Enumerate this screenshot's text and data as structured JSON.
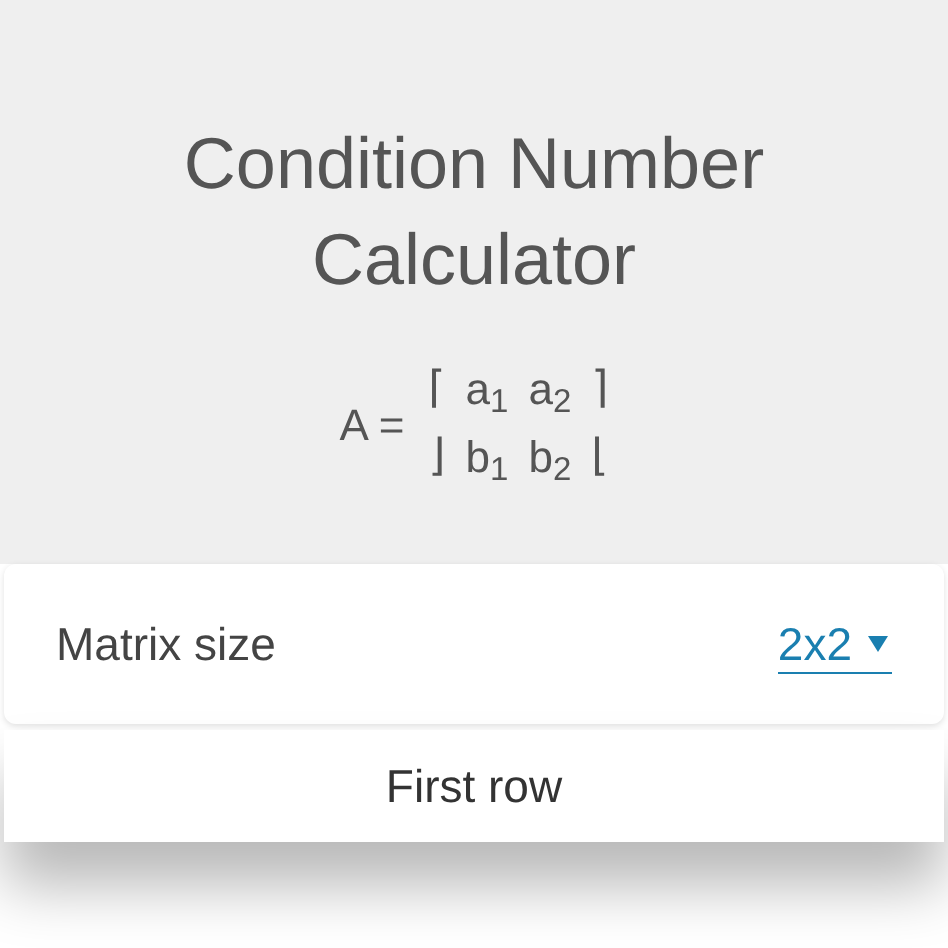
{
  "title": "Condition Number Calculator",
  "matrix": {
    "label": "A =",
    "rows": [
      {
        "left": "⌈",
        "cells": [
          "a$_{1}$",
          "a$_{2}$"
        ],
        "right": "⌉"
      },
      {
        "left": "⌋",
        "cells": [
          "b$_{1}$",
          "b$_{2}$"
        ],
        "right": "⌊"
      }
    ]
  },
  "matrix_size": {
    "label": "Matrix size",
    "value": "2x2"
  },
  "section": {
    "title": "First row"
  }
}
